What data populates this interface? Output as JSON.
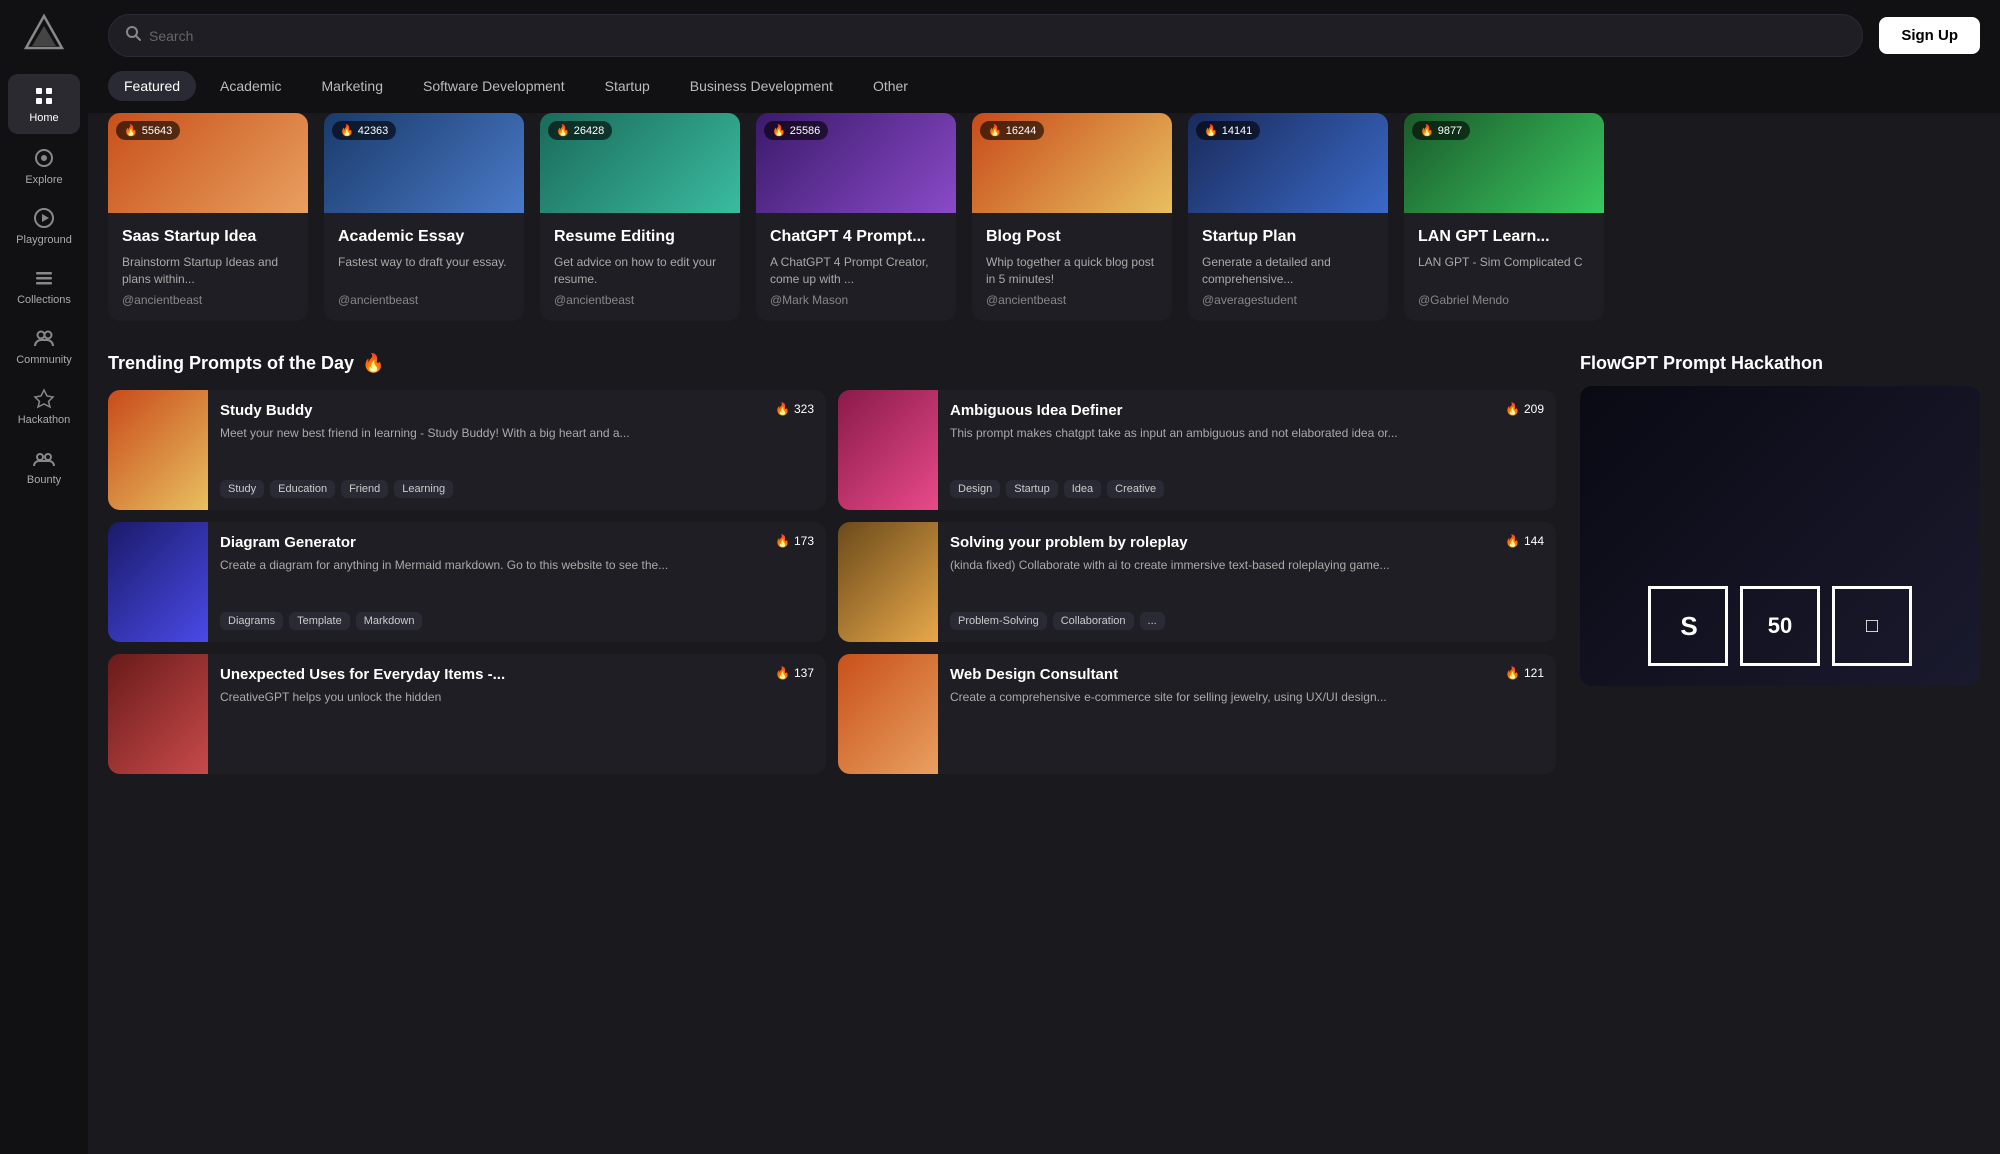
{
  "header": {
    "search_placeholder": "Search",
    "signup_label": "Sign Up"
  },
  "sidebar": {
    "logo": "▽",
    "items": [
      {
        "id": "home",
        "label": "Home",
        "icon": "⊞",
        "active": true
      },
      {
        "id": "explore",
        "label": "Explore",
        "icon": "◎",
        "active": false
      },
      {
        "id": "playground",
        "label": "Playground",
        "icon": "▶",
        "active": false
      },
      {
        "id": "collections",
        "label": "Collections",
        "icon": "≡",
        "active": false
      },
      {
        "id": "community",
        "label": "Community",
        "icon": "👥",
        "active": false
      },
      {
        "id": "hackathon",
        "label": "Hackathon",
        "icon": "🚀",
        "active": false
      },
      {
        "id": "bounty",
        "label": "Bounty",
        "icon": "🧑‍🤝‍🧑",
        "active": false
      }
    ]
  },
  "tabs": [
    {
      "id": "featured",
      "label": "Featured",
      "active": true
    },
    {
      "id": "academic",
      "label": "Academic",
      "active": false
    },
    {
      "id": "marketing",
      "label": "Marketing",
      "active": false
    },
    {
      "id": "software",
      "label": "Software Development",
      "active": false
    },
    {
      "id": "startup",
      "label": "Startup",
      "active": false
    },
    {
      "id": "business",
      "label": "Business Development",
      "active": false
    },
    {
      "id": "other",
      "label": "Other",
      "active": false
    }
  ],
  "featured_cards": [
    {
      "title": "Saas Startup Idea",
      "desc": "Brainstorm Startup Ideas and plans within...",
      "author": "@ancientbeast",
      "likes": "55643",
      "bg": "bg-orange"
    },
    {
      "title": "Academic Essay",
      "desc": "Fastest way to draft your essay.",
      "author": "@ancientbeast",
      "likes": "42363",
      "bg": "bg-blue"
    },
    {
      "title": "Resume Editing",
      "desc": "Get advice on how to edit your resume.",
      "author": "@ancientbeast",
      "likes": "26428",
      "bg": "bg-teal"
    },
    {
      "title": "ChatGPT 4 Prompt...",
      "desc": "A ChatGPT 4 Prompt Creator, come up with ...",
      "author": "@Mark Mason",
      "likes": "25586",
      "bg": "bg-purple"
    },
    {
      "title": "Blog Post",
      "desc": "Whip together a quick blog post in 5 minutes!",
      "author": "@ancientbeast",
      "likes": "16244",
      "bg": "bg-sunset"
    },
    {
      "title": "Startup Plan",
      "desc": "Generate a detailed and comprehensive...",
      "author": "@averagestudent",
      "likes": "14141",
      "bg": "bg-navy"
    },
    {
      "title": "LAN GPT Learn...",
      "desc": "LAN GPT - Sim Complicated C",
      "author": "@Gabriel Mendo",
      "likes": "9877",
      "bg": "bg-green"
    }
  ],
  "trending": {
    "section_title": "Trending Prompts of the Day",
    "emoji": "🔥",
    "cards": [
      {
        "title": "Study Buddy",
        "desc": "Meet your new best friend in learning - Study Buddy! With a big heart and a...",
        "likes": "323",
        "tags": [
          "Study",
          "Education",
          "Friend",
          "Learning"
        ],
        "bg": "bg-sunset"
      },
      {
        "title": "Ambiguous Idea Definer",
        "desc": "This prompt makes chatgpt take as input an ambiguous and not elaborated idea or...",
        "likes": "209",
        "tags": [
          "Design",
          "Startup",
          "Idea",
          "Creative"
        ],
        "bg": "bg-pink"
      },
      {
        "title": "Diagram Generator",
        "desc": "Create a diagram for anything in Mermaid markdown. Go to this website to see the...",
        "likes": "173",
        "tags": [
          "Diagrams",
          "Template",
          "Markdown"
        ],
        "bg": "bg-indigo"
      },
      {
        "title": "Solving your problem by roleplay",
        "desc": "(kinda fixed) Collaborate with ai to create immersive text-based roleplaying game...",
        "likes": "144",
        "tags": [
          "Problem-Solving",
          "Collaboration",
          "..."
        ],
        "bg": "bg-gold"
      },
      {
        "title": "Unexpected Uses for Everyday Items -...",
        "desc": "CreativeGPT helps you unlock the hidden",
        "likes": "137",
        "tags": [],
        "bg": "bg-red"
      },
      {
        "title": "Web Design Consultant",
        "desc": "Create a comprehensive e-commerce site for selling jewelry, using UX/UI design...",
        "likes": "121",
        "tags": [],
        "bg": "bg-orange"
      }
    ]
  },
  "hackathon": {
    "title": "FlowGPT Prompt Hackathon"
  }
}
